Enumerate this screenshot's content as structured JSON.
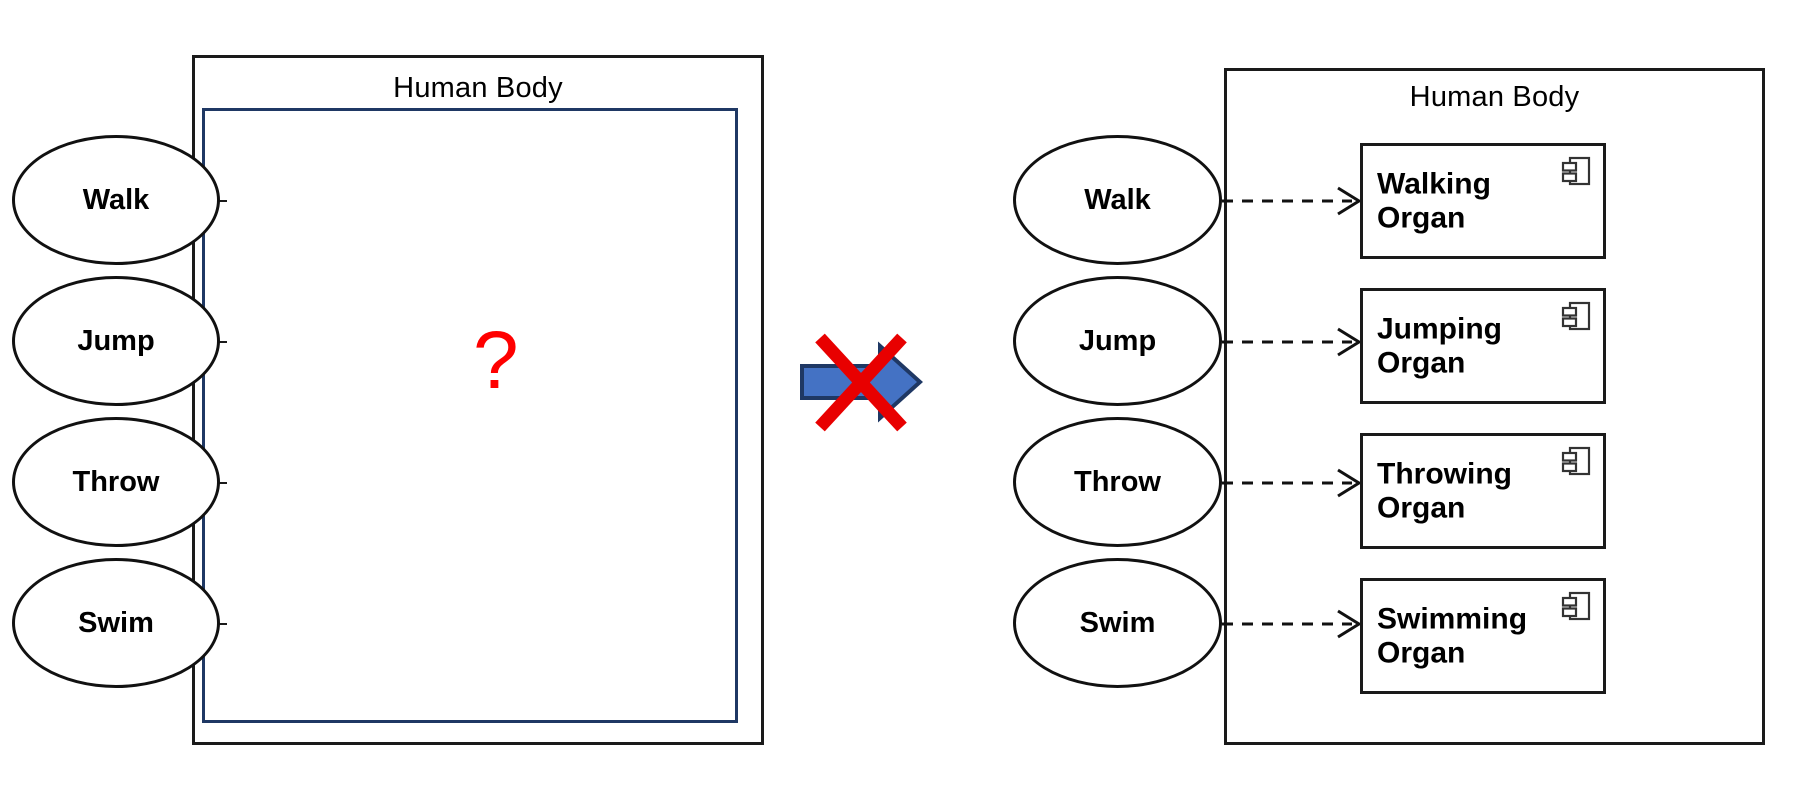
{
  "diagram": {
    "kind": "uml-component-diagram-comparison",
    "left": {
      "system_title": "Human Body",
      "inner_content_marker": "?",
      "marker_color": "#FF0000",
      "actors": [
        {
          "label": "Walk"
        },
        {
          "label": "Jump"
        },
        {
          "label": "Throw"
        },
        {
          "label": "Swim"
        }
      ],
      "components": []
    },
    "separator": {
      "icon": "crossed-out-right-arrow",
      "arrow_fill": "#4472C4",
      "arrow_stroke": "#1F3864",
      "cross_color": "#E80000"
    },
    "right": {
      "system_title": "Human Body",
      "actors": [
        {
          "label": "Walk"
        },
        {
          "label": "Jump"
        },
        {
          "label": "Throw"
        },
        {
          "label": "Swim"
        }
      ],
      "components": [
        {
          "line1": "Walking",
          "line2": "Organ",
          "icon": "uml-component-icon"
        },
        {
          "line1": "Jumping",
          "line2": "Organ",
          "icon": "uml-component-icon"
        },
        {
          "line1": "Throwing",
          "line2": "Organ",
          "icon": "uml-component-icon"
        },
        {
          "line1": "Swimming",
          "line2": "Organ",
          "icon": "uml-component-icon"
        }
      ],
      "connectors": [
        {
          "from": "Walk",
          "to": "Walking Organ",
          "style": "dashed-open-arrow"
        },
        {
          "from": "Jump",
          "to": "Jumping Organ",
          "style": "dashed-open-arrow"
        },
        {
          "from": "Throw",
          "to": "Throwing Organ",
          "style": "dashed-open-arrow"
        },
        {
          "from": "Swim",
          "to": "Swimming Organ",
          "style": "dashed-open-arrow"
        }
      ]
    }
  }
}
